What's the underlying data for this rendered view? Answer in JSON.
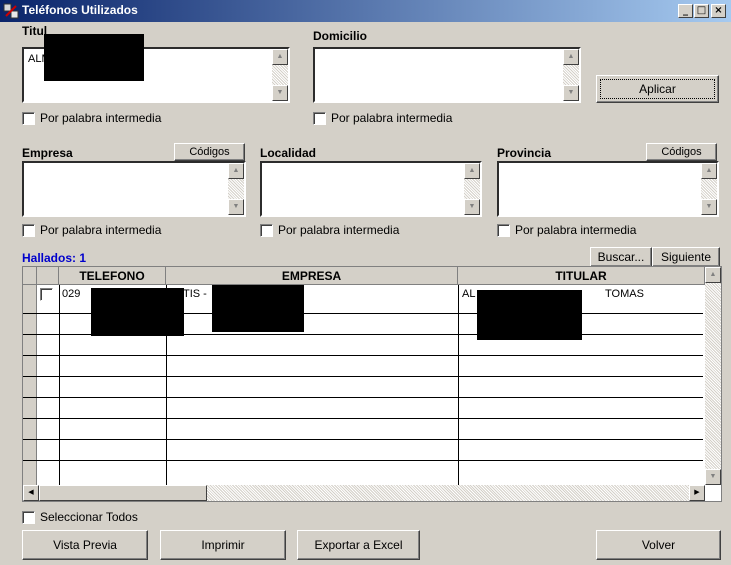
{
  "window": {
    "title": "Teléfonos Utilizados",
    "min": "_",
    "max": "□",
    "close": "×"
  },
  "titular": {
    "label": "Titul",
    "value": "ALM",
    "checkbox": "Por palabra intermedia"
  },
  "domicilio": {
    "label": "Domicilio",
    "value": "",
    "checkbox": "Por palabra intermedia"
  },
  "aplicar": {
    "label": "Aplicar"
  },
  "empresa": {
    "label": "Empresa",
    "codigos": "Códigos",
    "checkbox": "Por palabra intermedia"
  },
  "localidad": {
    "label": "Localidad",
    "checkbox": "Por palabra intermedia"
  },
  "provincia": {
    "label": "Provincia",
    "codigos": "Códigos",
    "checkbox": "Por palabra intermedia"
  },
  "hallados": "Hallados:  1",
  "buscar": "Buscar...",
  "siguiente": "Siguiente",
  "grid": {
    "headers": [
      "TELEFONO",
      "EMPRESA",
      "TITULAR"
    ],
    "rows": [
      {
        "telefono": "029",
        "empresa": "TIS -",
        "titular_start": "AL",
        "titular_end": "TOMAS"
      }
    ]
  },
  "seleccionar_todos": "Seleccionar Todos",
  "buttons": {
    "vista_previa": "Vista Previa",
    "imprimir": "Imprimir",
    "exportar": "Exportar a Excel",
    "volver": "Volver"
  },
  "colors": {
    "hallados": "#0000cc",
    "titlebar_start": "#0a246a",
    "titlebar_end": "#a6caf0"
  }
}
